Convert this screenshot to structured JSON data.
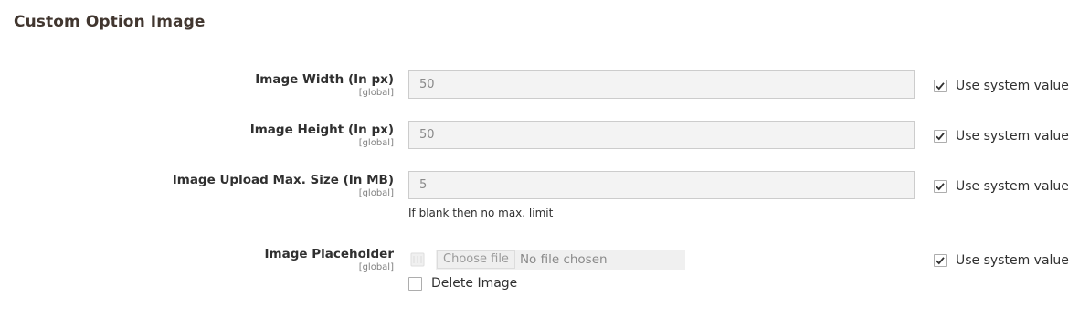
{
  "section": {
    "title": "Custom Option Image"
  },
  "fields": [
    {
      "label": "Image Width (In px)",
      "scope": "[global]",
      "value": "50",
      "use_system": "Use system value"
    },
    {
      "label": "Image Height (In px)",
      "scope": "[global]",
      "value": "50",
      "use_system": "Use system value"
    },
    {
      "label": "Image Upload Max. Size (In MB)",
      "scope": "[global]",
      "value": "5",
      "note": "If blank then no max. limit",
      "use_system": "Use system value"
    }
  ],
  "placeholder": {
    "label": "Image Placeholder",
    "scope": "[global]",
    "choose_label": "Choose file",
    "no_file": "No file chosen",
    "delete_label": "Delete Image",
    "use_system": "Use system value"
  },
  "colors": {
    "checkmark": "#303030",
    "field_bg": "#f3f3f3",
    "title": "#41362f"
  }
}
